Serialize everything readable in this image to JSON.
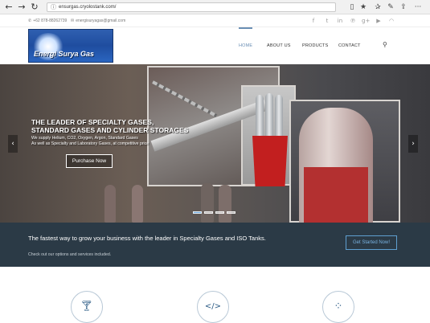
{
  "browser": {
    "url": "ensurgas.cryolostank.com/",
    "back_glyph": "←",
    "forward_glyph": "→",
    "reload_glyph": "↻",
    "site_info_glyph": "ⓘ",
    "reading_view_glyph": "▯",
    "favorite_glyph": "★",
    "hub_glyph": "✰",
    "notes_glyph": "✎",
    "share_glyph": "⇪",
    "more_glyph": "···",
    "icons": [
      "back-icon",
      "forward-icon",
      "reload-icon",
      "site-info-icon",
      "reading-view-icon",
      "favorite-icon",
      "hub-icon",
      "notes-icon",
      "share-icon",
      "more-icon"
    ]
  },
  "topbar": {
    "phone_glyph": "✆",
    "phone": "+62 878-88262739",
    "email_glyph": "✉",
    "email": "energisuryagas@gmail.com",
    "social": [
      {
        "name": "facebook-icon",
        "glyph": "f"
      },
      {
        "name": "twitter-icon",
        "glyph": "t"
      },
      {
        "name": "linkedin-icon",
        "glyph": "in"
      },
      {
        "name": "pinterest-icon",
        "glyph": "℗"
      },
      {
        "name": "google-plus-icon",
        "glyph": "g+"
      },
      {
        "name": "youtube-icon",
        "glyph": "▶"
      },
      {
        "name": "rss-icon",
        "glyph": "◠"
      }
    ]
  },
  "header": {
    "logo_text": "Energi Surya Gas",
    "menu": {
      "home": "HOME",
      "about": "ABOUT US",
      "products": "PRODUCTS",
      "contact": "CONTACT"
    },
    "search_glyph": "⚲"
  },
  "hero": {
    "title_line1": "THE LEADER OF SPECIALTY GASES,",
    "title_line2": "STANDARD GASES AND CYLINDER STORAGES",
    "sub_line1": "We supply Helium, CO2, Oxygen, Argon, Standard Gases",
    "sub_line2": "As well as Specialty and Laboratory Gases, at competitive price",
    "button": "Purchase Now",
    "prev_glyph": "‹",
    "next_glyph": "›",
    "slide_count": 4,
    "active_slide": 1,
    "colors": {
      "cylinder_red": "#c21f1f",
      "cylinder_silver": "#c9cdd2"
    }
  },
  "cta": {
    "title": "The fastest way to grow your business with the leader in Specialty Gases and ISO Tanks.",
    "subtitle": "Check out our options and services included.",
    "button": "Get Started Now!",
    "colors": {
      "background": "#2b3a46",
      "accent": "#5f9fd0"
    }
  },
  "features": [
    {
      "icon": "cocktail-glass-icon",
      "glyph": "🍸︎"
    },
    {
      "icon": "code-icon",
      "glyph": "</>"
    },
    {
      "icon": "spinner-icon",
      "glyph": "⁘"
    }
  ]
}
